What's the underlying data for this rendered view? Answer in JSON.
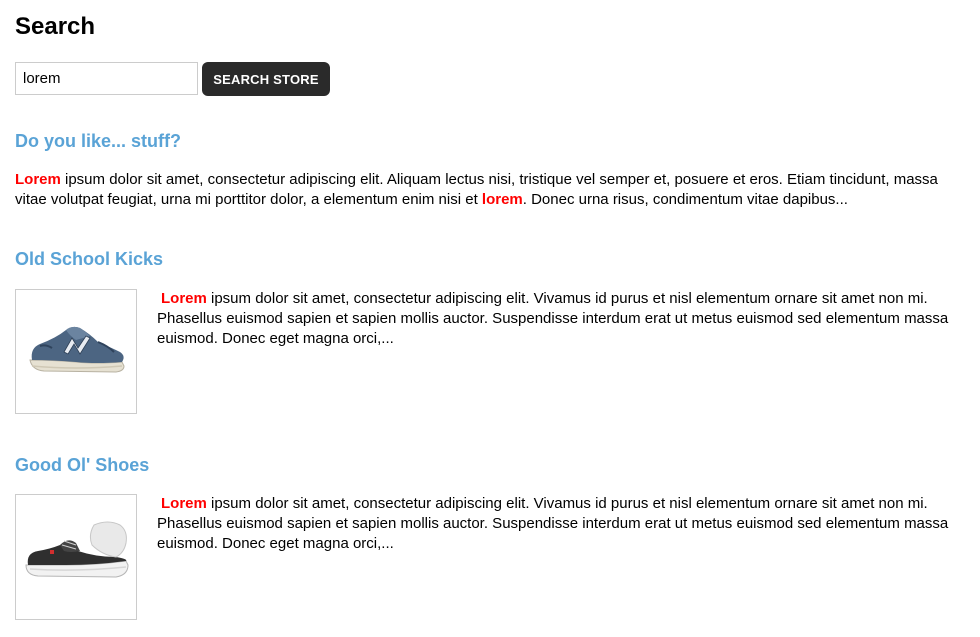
{
  "page": {
    "title": "Search"
  },
  "search": {
    "value": "lorem",
    "button_label": "SEARCH STORE"
  },
  "results": [
    {
      "title": "Do you like... stuff?",
      "snippet_parts": [
        {
          "text": "Lorem",
          "highlight": true
        },
        {
          "text": " ipsum dolor sit amet, consectetur adipiscing elit. Aliquam lectus nisi, tristique vel semper et, posuere et eros. Etiam tincidunt, massa vitae volutpat feugiat, urna mi porttitor dolor, a elementum enim nisi et ",
          "highlight": false
        },
        {
          "text": "lorem",
          "highlight": true
        },
        {
          "text": ". Donec urna risus, condimentum vitae dapibus...",
          "highlight": false
        }
      ]
    },
    {
      "title": "Old School Kicks",
      "image_icon": "sneaker-icon",
      "snippet_parts": [
        {
          "text": "Lorem",
          "highlight": true
        },
        {
          "text": " ipsum dolor sit amet, consectetur adipiscing elit. Vivamus id purus et nisl elementum ornare sit amet non mi. Phasellus euismod sapien et sapien mollis auctor. Suspendisse interdum erat ut metus euismod sed elementum massa euismod. Donec eget magna orci,...",
          "highlight": false
        }
      ]
    },
    {
      "title": "Good Ol' Shoes",
      "image_icon": "shoe-icon",
      "snippet_parts": [
        {
          "text": "Lorem",
          "highlight": true
        },
        {
          "text": " ipsum dolor sit amet, consectetur adipiscing elit. Vivamus id purus et nisl elementum ornare sit amet non mi. Phasellus euismod sapien et sapien mollis auctor. Suspendisse interdum erat ut metus euismod sed elementum massa euismod. Donec eget magna orci,...",
          "highlight": false
        }
      ]
    }
  ],
  "colors": {
    "result_title": "#5aa3d6",
    "highlight": "#ff0000",
    "button_bg": "#2a2a2a"
  }
}
